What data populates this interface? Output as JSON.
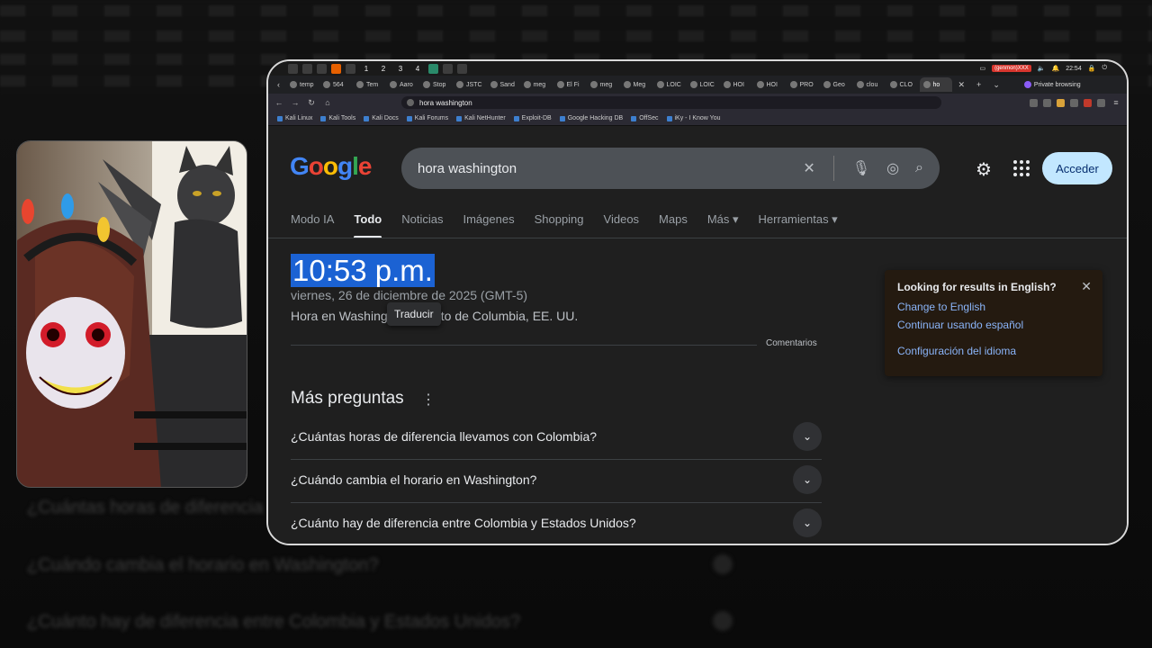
{
  "panel": {
    "workspaces": [
      "1",
      "2",
      "3",
      "4"
    ],
    "genmon": "(genmon)XXX",
    "clock": "22:54"
  },
  "browser": {
    "tabs": [
      "temp",
      "564",
      "Tem",
      "Aaro",
      "Stop",
      "JSTC",
      "Sand",
      "meg",
      "El Fi",
      "meg",
      "Meg",
      "LOIC",
      "LOIC",
      "HOI",
      "HOI",
      "PRO",
      "Geo",
      "clou",
      "CLO",
      "ho"
    ],
    "private_label": "Private browsing",
    "url": "hora washington",
    "bookmarks": [
      "Kali Linux",
      "Kali Tools",
      "Kali Docs",
      "Kali Forums",
      "Kali NetHunter",
      "Exploit-DB",
      "Google Hacking DB",
      "OffSec",
      "iKy - I Know You"
    ]
  },
  "google": {
    "logo": "Google",
    "query": "hora washington",
    "signin": "Acceder",
    "nav_tabs": [
      "Modo IA",
      "Todo",
      "Noticias",
      "Imágenes",
      "Shopping",
      "Videos",
      "Maps",
      "Más ▾",
      "Herramientas ▾"
    ],
    "time": "10:53 p.m.",
    "date": "viernes, 26 de diciembre de 2025 (GMT-5)",
    "place": "Hora en Washington, Distrito de Columbia, EE. UU.",
    "translate_tooltip": "Traducir",
    "feedback": "Comentarios",
    "more_questions": "Más preguntas",
    "faq": [
      "¿Cuántas horas de diferencia llevamos con Colombia?",
      "¿Cuándo cambia el horario en Washington?",
      "¿Cuánto hay de diferencia entre Colombia y Estados Unidos?"
    ],
    "popup": {
      "title": "Looking for results in English?",
      "change": "Change to English",
      "continue": "Continuar usando español",
      "settings": "Configuración del idioma"
    }
  },
  "background_ghost": [
    "¿Cuántas horas de diferencia llevamos con Colombia?",
    "¿Cuándo cambia el horario en Washington?",
    "¿Cuánto hay de diferencia entre Colombia y Estados Unidos?"
  ],
  "colors": {
    "selection": "#1b62d3",
    "signin_bg": "#c2e7ff",
    "link": "#8ab4f8",
    "popup_bg": "#241a10"
  }
}
